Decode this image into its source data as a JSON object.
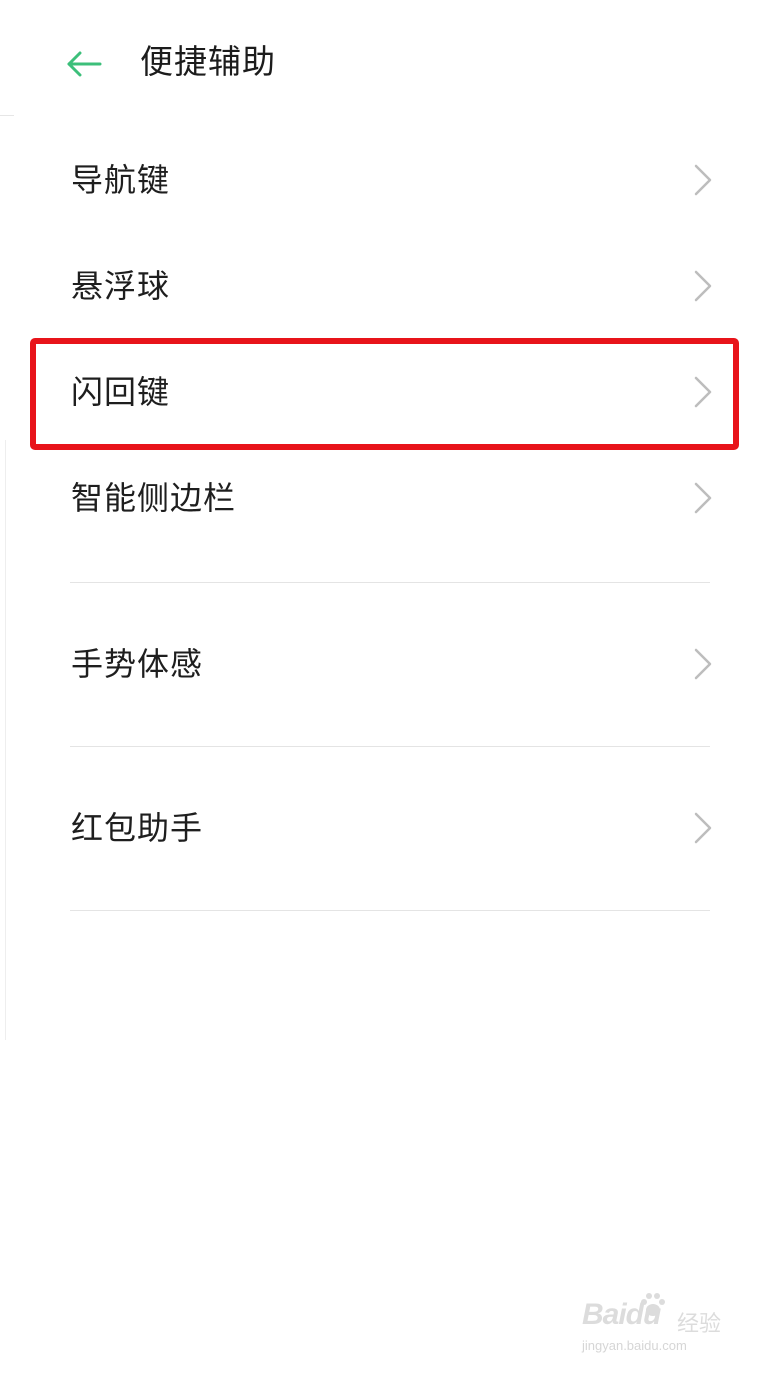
{
  "header": {
    "title": "便捷辅助",
    "back_icon": "arrow-left-icon",
    "accent_color": "#3cbf7a"
  },
  "list": {
    "items": [
      {
        "label": "导航键",
        "icon": "chevron-right-icon"
      },
      {
        "label": "悬浮球",
        "icon": "chevron-right-icon"
      },
      {
        "label": "闪回键",
        "icon": "chevron-right-icon",
        "highlighted": true
      },
      {
        "label": "智能侧边栏",
        "icon": "chevron-right-icon"
      },
      {
        "label": "手势体感",
        "icon": "chevron-right-icon"
      },
      {
        "label": "红包助手",
        "icon": "chevron-right-icon"
      }
    ]
  },
  "highlight": {
    "color": "#e8141a"
  },
  "watermark": {
    "logo": "Baidu",
    "brand": "经验",
    "url": "jingyan.baidu.com"
  }
}
